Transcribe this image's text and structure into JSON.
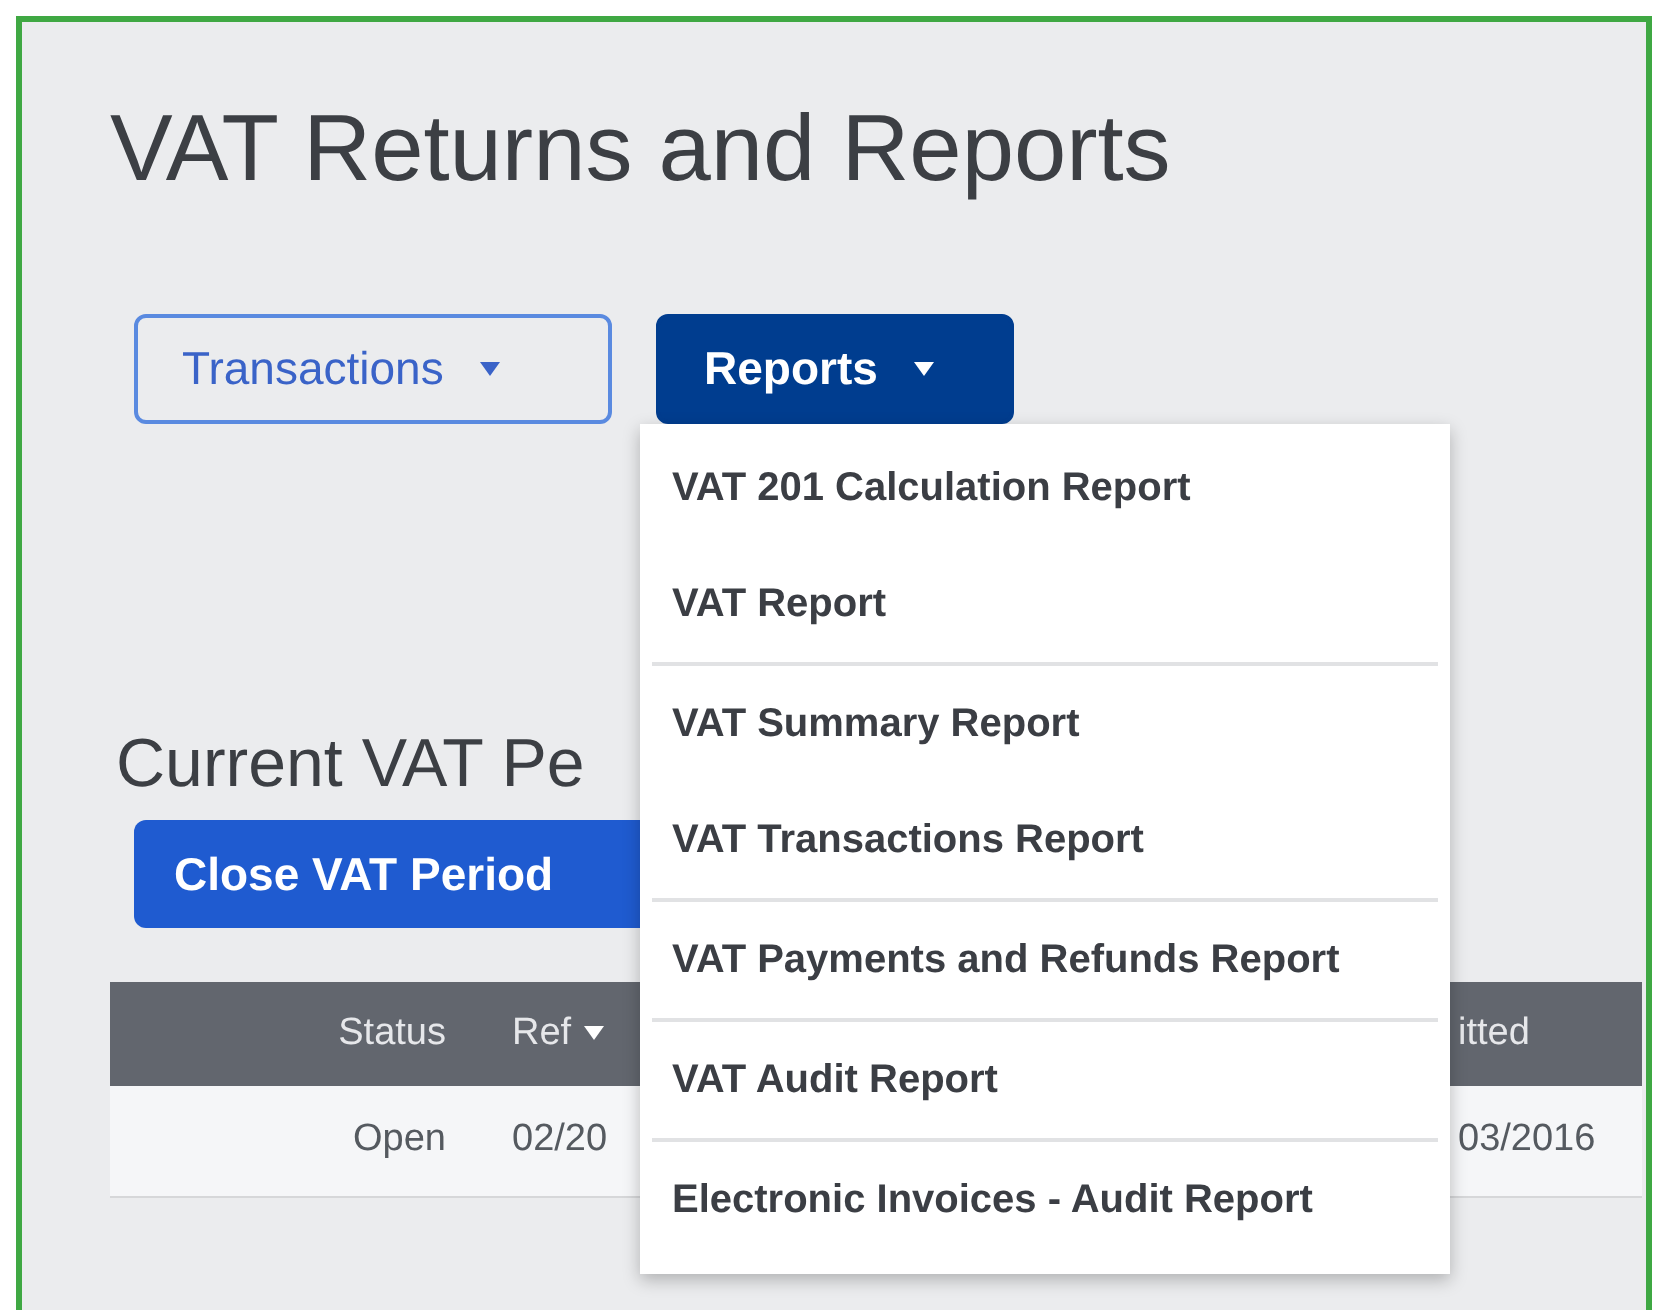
{
  "title": "VAT Returns and Reports",
  "menus": [
    {
      "label": "Transactions",
      "expanded": false
    },
    {
      "label": "Reports",
      "expanded": true
    }
  ],
  "dropdown_items": [
    {
      "label": "VAT 201 Calculation Report",
      "divider_before": false
    },
    {
      "label": "VAT Report",
      "divider_before": false
    },
    {
      "label": "VAT Summary Report",
      "divider_before": true
    },
    {
      "label": "VAT Transactions Report",
      "divider_before": false
    },
    {
      "label": "VAT Payments and Refunds Report",
      "divider_before": true
    },
    {
      "label": "VAT Audit Report",
      "divider_before": true
    },
    {
      "label": "Electronic Invoices - Audit Report",
      "divider_before": true
    }
  ],
  "section": {
    "heading": "Current VAT Pe",
    "button": "Close VAT Period"
  },
  "table": {
    "columns": [
      {
        "label": "Status",
        "sortable": false
      },
      {
        "label": "Ref",
        "sortable": true
      },
      {
        "label": "itted",
        "sortable": false
      }
    ],
    "rows": [
      [
        "Open",
        "02/20",
        "03/2016"
      ]
    ]
  }
}
